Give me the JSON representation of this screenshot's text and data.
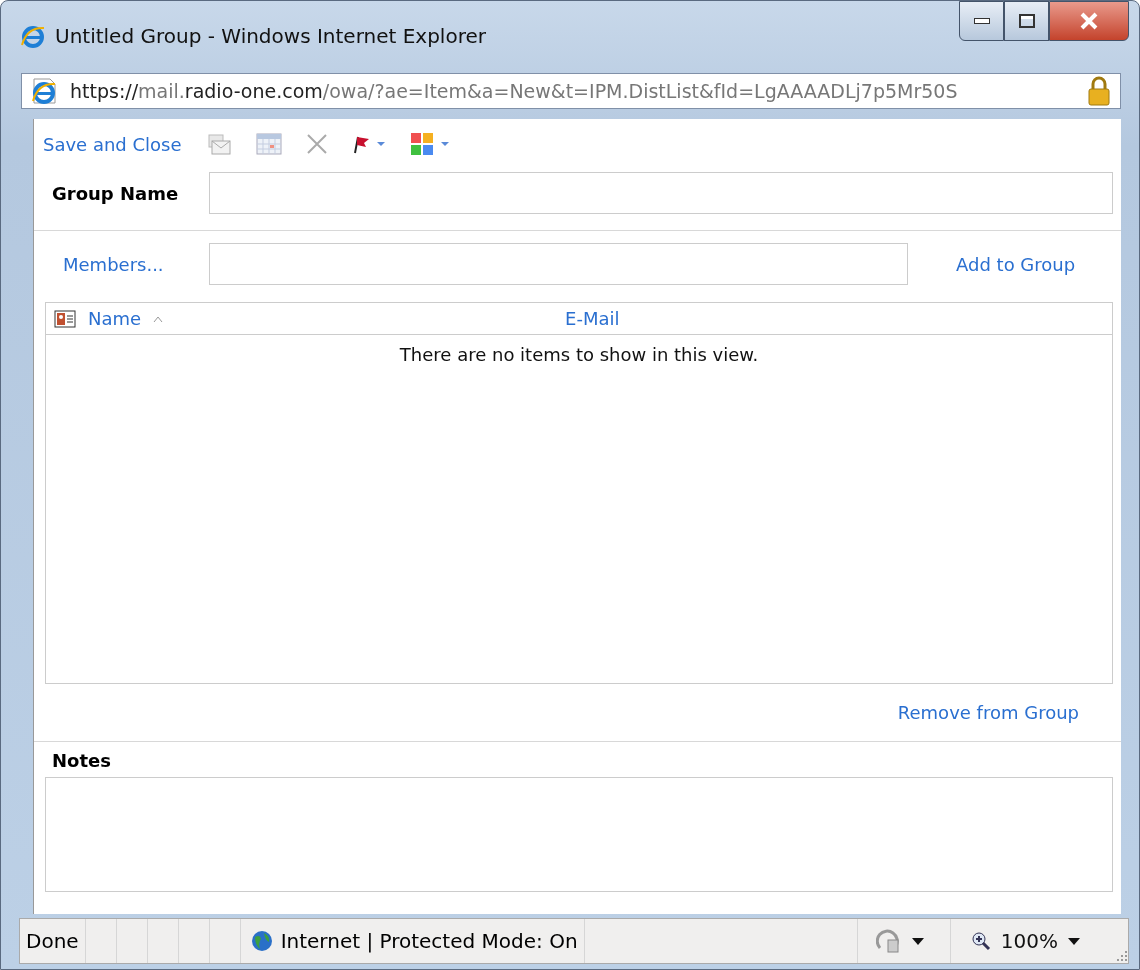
{
  "window": {
    "title": "Untitled Group - Windows Internet Explorer"
  },
  "address_bar": {
    "url_parts": [
      {
        "text": "https://",
        "dim": false
      },
      {
        "text": "mail.",
        "dim": true
      },
      {
        "text": "radio-one.com",
        "dim": false
      },
      {
        "text": "/owa/?ae=Item&a=New&t=IPM.DistList&fId=LgAAAADLj7p5Mr50S",
        "dim": true
      }
    ]
  },
  "toolbar": {
    "save_label": "Save and Close"
  },
  "form": {
    "group_name_label": "Group Name",
    "members_button": "Members...",
    "add_button": "Add to Group",
    "table": {
      "columns": [
        "Name",
        "E-Mail"
      ],
      "empty_message": "There are no items to show in this view."
    },
    "remove_button": "Remove from Group",
    "notes_label": "Notes"
  },
  "status_bar": {
    "status": "Done",
    "zone": "Internet | Protected Mode: On",
    "zoom": "100%"
  }
}
